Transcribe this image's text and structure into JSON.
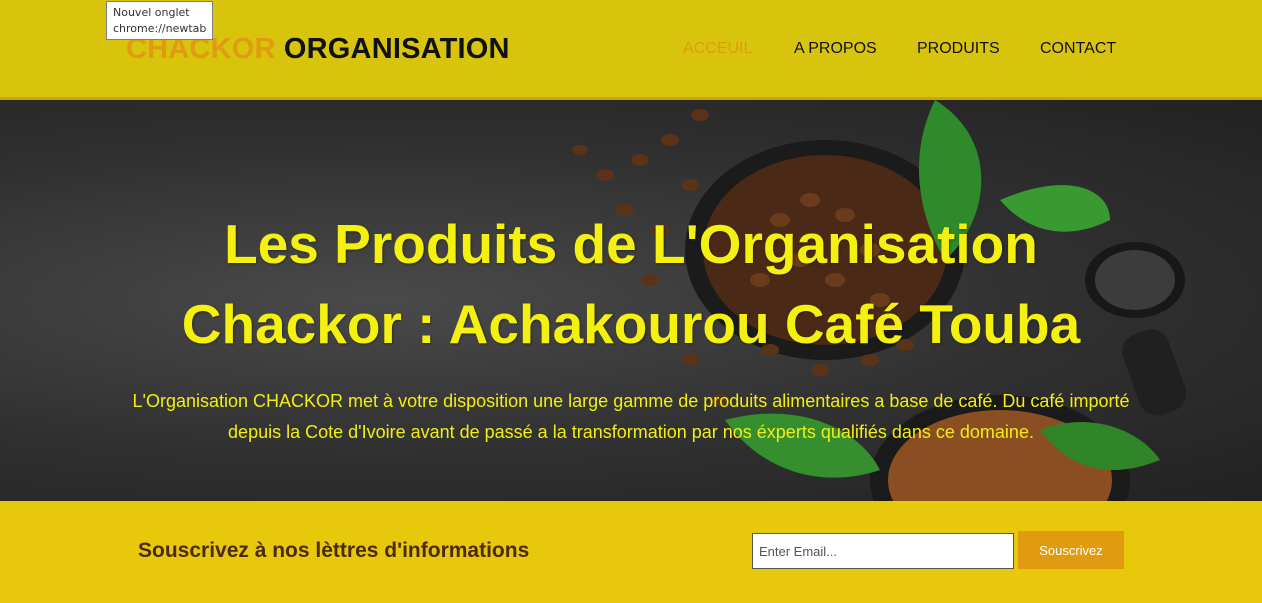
{
  "tooltip": {
    "title": "Nouvel onglet",
    "url": "chrome://newtab"
  },
  "header": {
    "logo_part1": "CHACKOR",
    "logo_part2": "ORGANISATION",
    "nav": [
      {
        "label": "ACCEUIL",
        "active": true
      },
      {
        "label": "A PROPOS",
        "active": false
      },
      {
        "label": "PRODUITS",
        "active": false
      },
      {
        "label": "CONTACT",
        "active": false
      }
    ]
  },
  "hero": {
    "title_line1": "Les Produits de L'Organisation",
    "title_line2": "Chackor : Achakourou Café Touba",
    "description": "L'Organisation CHACKOR met à votre disposition une large gamme de produits alimentaires a base de café. Du café importé depuis la Cote d'Ivoire avant de passé a la transformation par nos éxperts qualifiés dans ce domaine."
  },
  "newsletter": {
    "heading": "Souscrivez à nos lèttres d'informations",
    "email_placeholder": "Enter Email...",
    "button_label": "Souscrivez"
  },
  "colors": {
    "header_bg": "#d8c40c",
    "accent": "#e09b10",
    "hero_text": "#f4f010",
    "newsletter_bg": "#e8c80a"
  }
}
